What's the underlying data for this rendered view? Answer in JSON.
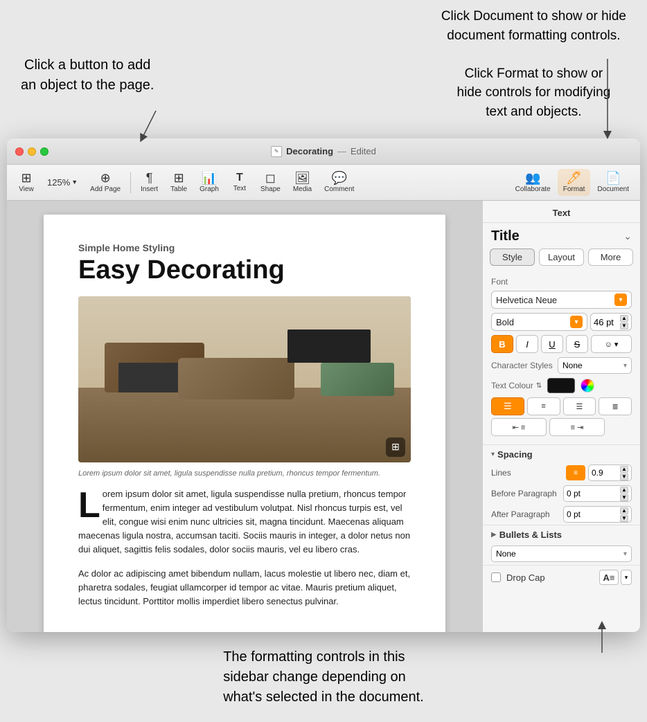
{
  "annotations": {
    "top_left": "Click a button to add\nan object to the page.",
    "top_right": "Click Document to show or hide\ndocument formatting controls.\n\nClick Format to show or\nhide controls for modifying\ntext and objects.",
    "bottom": "The formatting controls in this\nsidebar change depending on\nwhat's selected in the document."
  },
  "window": {
    "title": "Decorating",
    "status": "Edited",
    "doc_icon": "📄"
  },
  "toolbar": {
    "view_label": "View",
    "zoom_label": "125%",
    "add_page_label": "Add Page",
    "insert_label": "Insert",
    "table_label": "Table",
    "graph_label": "Graph",
    "text_label": "Text",
    "shape_label": "Shape",
    "media_label": "Media",
    "comment_label": "Comment",
    "collaborate_label": "Collaborate",
    "format_label": "Format",
    "document_label": "Document"
  },
  "document": {
    "subtitle": "Simple Home Styling",
    "title": "Easy Decorating",
    "image_caption": "Lorem ipsum dolor sit amet, ligula suspendisse nulla pretium, rhoncus tempor fermentum.",
    "drop_cap_para": "orem ipsum dolor sit amet, ligula suspendisse nulla pretium, rhoncus tempor fermentum, enim integer ad vestibulum volutpat. Nisl rhoncus turpis est, vel elit, congue wisi enim nunc ultricies sit, magna tincidunt. Maecenas aliquam maecenas ligula nostra, accumsan taciti. Sociis mauris in integer, a dolor netus non dui aliquet, sagittis felis sodales, dolor sociis mauris, vel eu libero cras.",
    "body_para": "Ac dolor ac adipiscing amet bibendum nullam, lacus molestie ut libero nec, diam et, pharetra sodales, feugiat ullamcorper id tempor ac vitae. Mauris pretium aliquet, lectus tincidunt. Porttitor mollis imperdiet libero senectus pulvinar."
  },
  "sidebar": {
    "header": "Text",
    "style_name": "Title",
    "tabs": [
      {
        "label": "Style",
        "active": true
      },
      {
        "label": "Layout",
        "active": false
      },
      {
        "label": "More",
        "active": false
      }
    ],
    "font_section_label": "Font",
    "font_name": "Helvetica Neue",
    "font_weight": "Bold",
    "font_size": "46 pt",
    "format_buttons": [
      {
        "label": "B",
        "type": "bold",
        "active": true
      },
      {
        "label": "I",
        "type": "italic",
        "active": false
      },
      {
        "label": "U",
        "type": "underline",
        "active": false
      },
      {
        "label": "S",
        "type": "strikethrough",
        "active": false
      }
    ],
    "char_styles_label": "Character Styles",
    "char_styles_value": "None",
    "text_color_label": "Text Colour",
    "alignment_buttons": [
      "left",
      "center",
      "right",
      "justify"
    ],
    "indent_buttons": [
      "indent-in",
      "indent-out"
    ],
    "spacing": {
      "label": "Spacing",
      "lines_label": "Lines",
      "lines_value": "0.9",
      "before_para_label": "Before Paragraph",
      "before_para_value": "0 pt",
      "after_para_label": "After Paragraph",
      "after_para_value": "0 pt"
    },
    "bullets_label": "Bullets & Lists",
    "bullets_value": "None",
    "drop_cap_label": "Drop Cap"
  }
}
